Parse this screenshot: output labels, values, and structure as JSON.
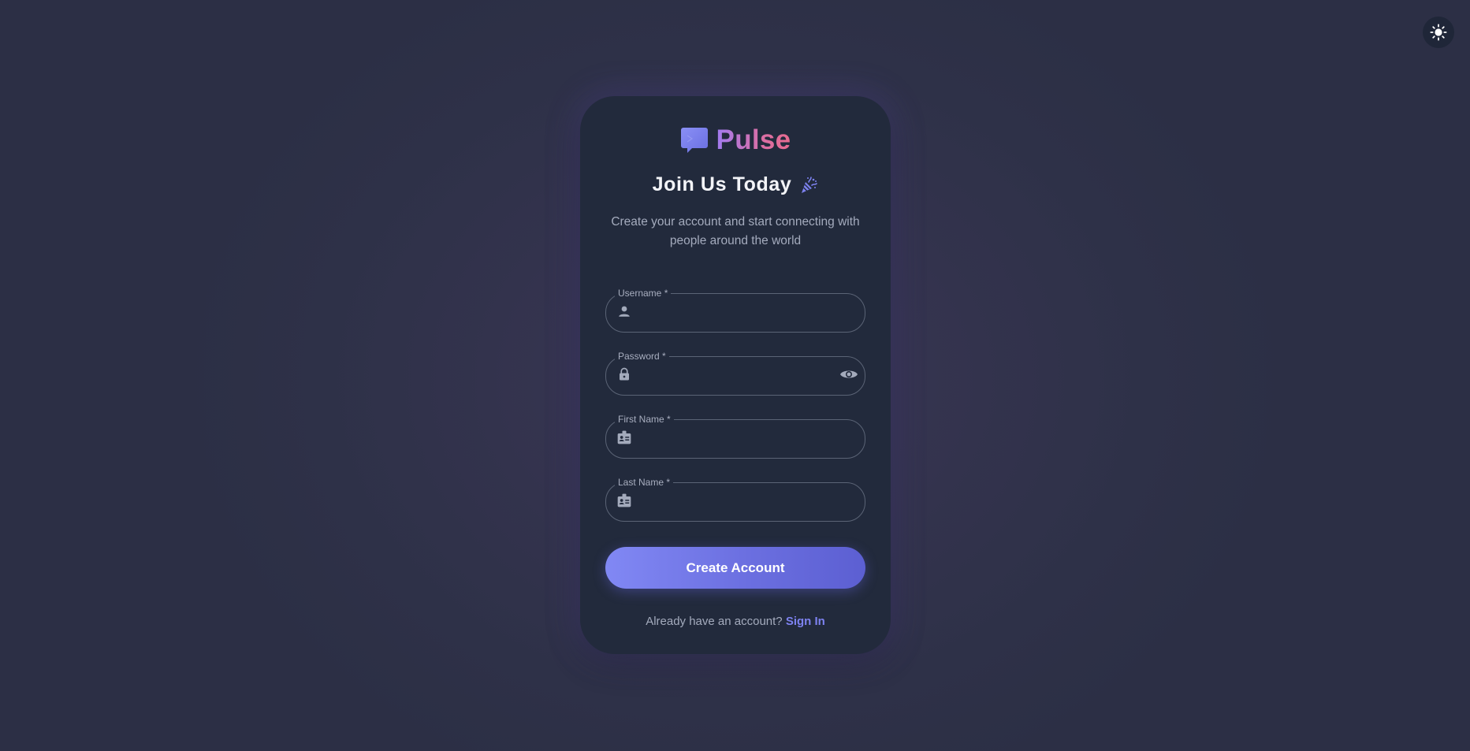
{
  "brand": {
    "name": "Pulse",
    "icon": "chat-bubble-icon"
  },
  "header": {
    "title": "Join Us Today",
    "title_icon": "party-popper-icon",
    "subtitle": "Create your account and start connecting with people around the world"
  },
  "form": {
    "fields": [
      {
        "label": "Username *",
        "icon": "user-icon",
        "value": "",
        "type": "text"
      },
      {
        "label": "Password *",
        "icon": "lock-icon",
        "value": "",
        "type": "password",
        "toggle_icon": "eye-icon"
      },
      {
        "label": "First Name *",
        "icon": "id-card-icon",
        "value": "",
        "type": "text"
      },
      {
        "label": "Last Name *",
        "icon": "id-card-icon",
        "value": "",
        "type": "text"
      }
    ],
    "submit_label": "Create Account"
  },
  "footer": {
    "prompt": "Already have an account?",
    "link_label": "Sign In"
  },
  "theme_toggle": {
    "icon": "sun-icon"
  },
  "colors": {
    "accent": "#7d82f0",
    "brand_gradient_start": "#a27bf0",
    "brand_gradient_end": "#e86b8f",
    "card_bg": "#222a3c",
    "page_bg": "#2e3148"
  }
}
